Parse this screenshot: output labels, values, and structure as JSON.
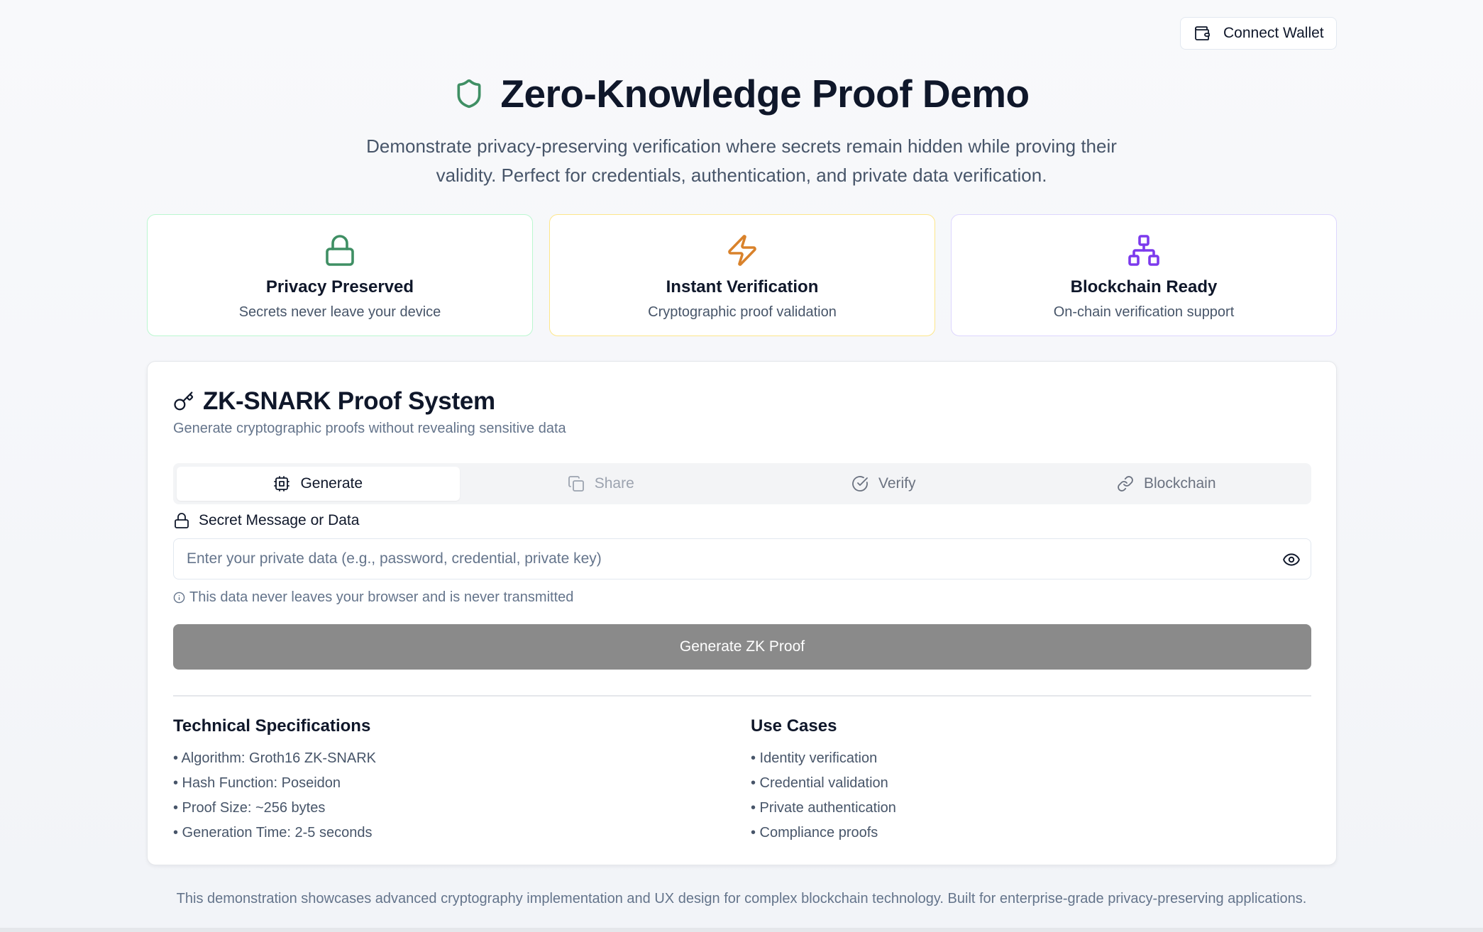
{
  "header": {
    "connect_wallet_label": "Connect Wallet"
  },
  "hero": {
    "title": "Zero-Knowledge Proof Demo",
    "subtitle": "Demonstrate privacy-preserving verification where secrets remain hidden while proving their validity. Perfect for credentials, authentication, and private data verification."
  },
  "features": [
    {
      "title": "Privacy Preserved",
      "subtitle": "Secrets never leave your device",
      "icon": "lock-icon",
      "color": "#3f8f64"
    },
    {
      "title": "Instant Verification",
      "subtitle": "Cryptographic proof validation",
      "icon": "lightning-icon",
      "color": "#d9822b"
    },
    {
      "title": "Blockchain Ready",
      "subtitle": "On-chain verification support",
      "icon": "network-icon",
      "color": "#7c3aed"
    }
  ],
  "card": {
    "title": "ZK-SNARK Proof System",
    "subtitle": "Generate cryptographic proofs without revealing sensitive data",
    "tabs": [
      {
        "label": "Generate",
        "icon": "cpu-icon",
        "state": "active"
      },
      {
        "label": "Share",
        "icon": "copy-icon",
        "state": "disabled"
      },
      {
        "label": "Verify",
        "icon": "check-circle-icon",
        "state": "inactive"
      },
      {
        "label": "Blockchain",
        "icon": "link-icon",
        "state": "inactive"
      }
    ],
    "field_label": "Secret Message or Data",
    "input": {
      "value": "",
      "placeholder": "Enter your private data (e.g., password, credential, private key)"
    },
    "note": "This data never leaves your browser and is never transmitted",
    "generate_button_label": "Generate ZK Proof",
    "tech_specs": {
      "title": "Technical Specifications",
      "items": [
        "• Algorithm: Groth16 ZK-SNARK",
        "• Hash Function: Poseidon",
        "• Proof Size: ~256 bytes",
        "• Generation Time: 2-5 seconds"
      ]
    },
    "use_cases": {
      "title": "Use Cases",
      "items": [
        "• Identity verification",
        "• Credential validation",
        "• Private authentication",
        "• Compliance proofs"
      ]
    }
  },
  "footer": "This demonstration showcases advanced cryptography implementation and UX design for complex blockchain technology. Built for enterprise-grade privacy-preserving applications.",
  "colors": {
    "accent_green": "#3f8f64",
    "button_gray": "#8a8a8a",
    "text_dark": "#0f172a"
  }
}
